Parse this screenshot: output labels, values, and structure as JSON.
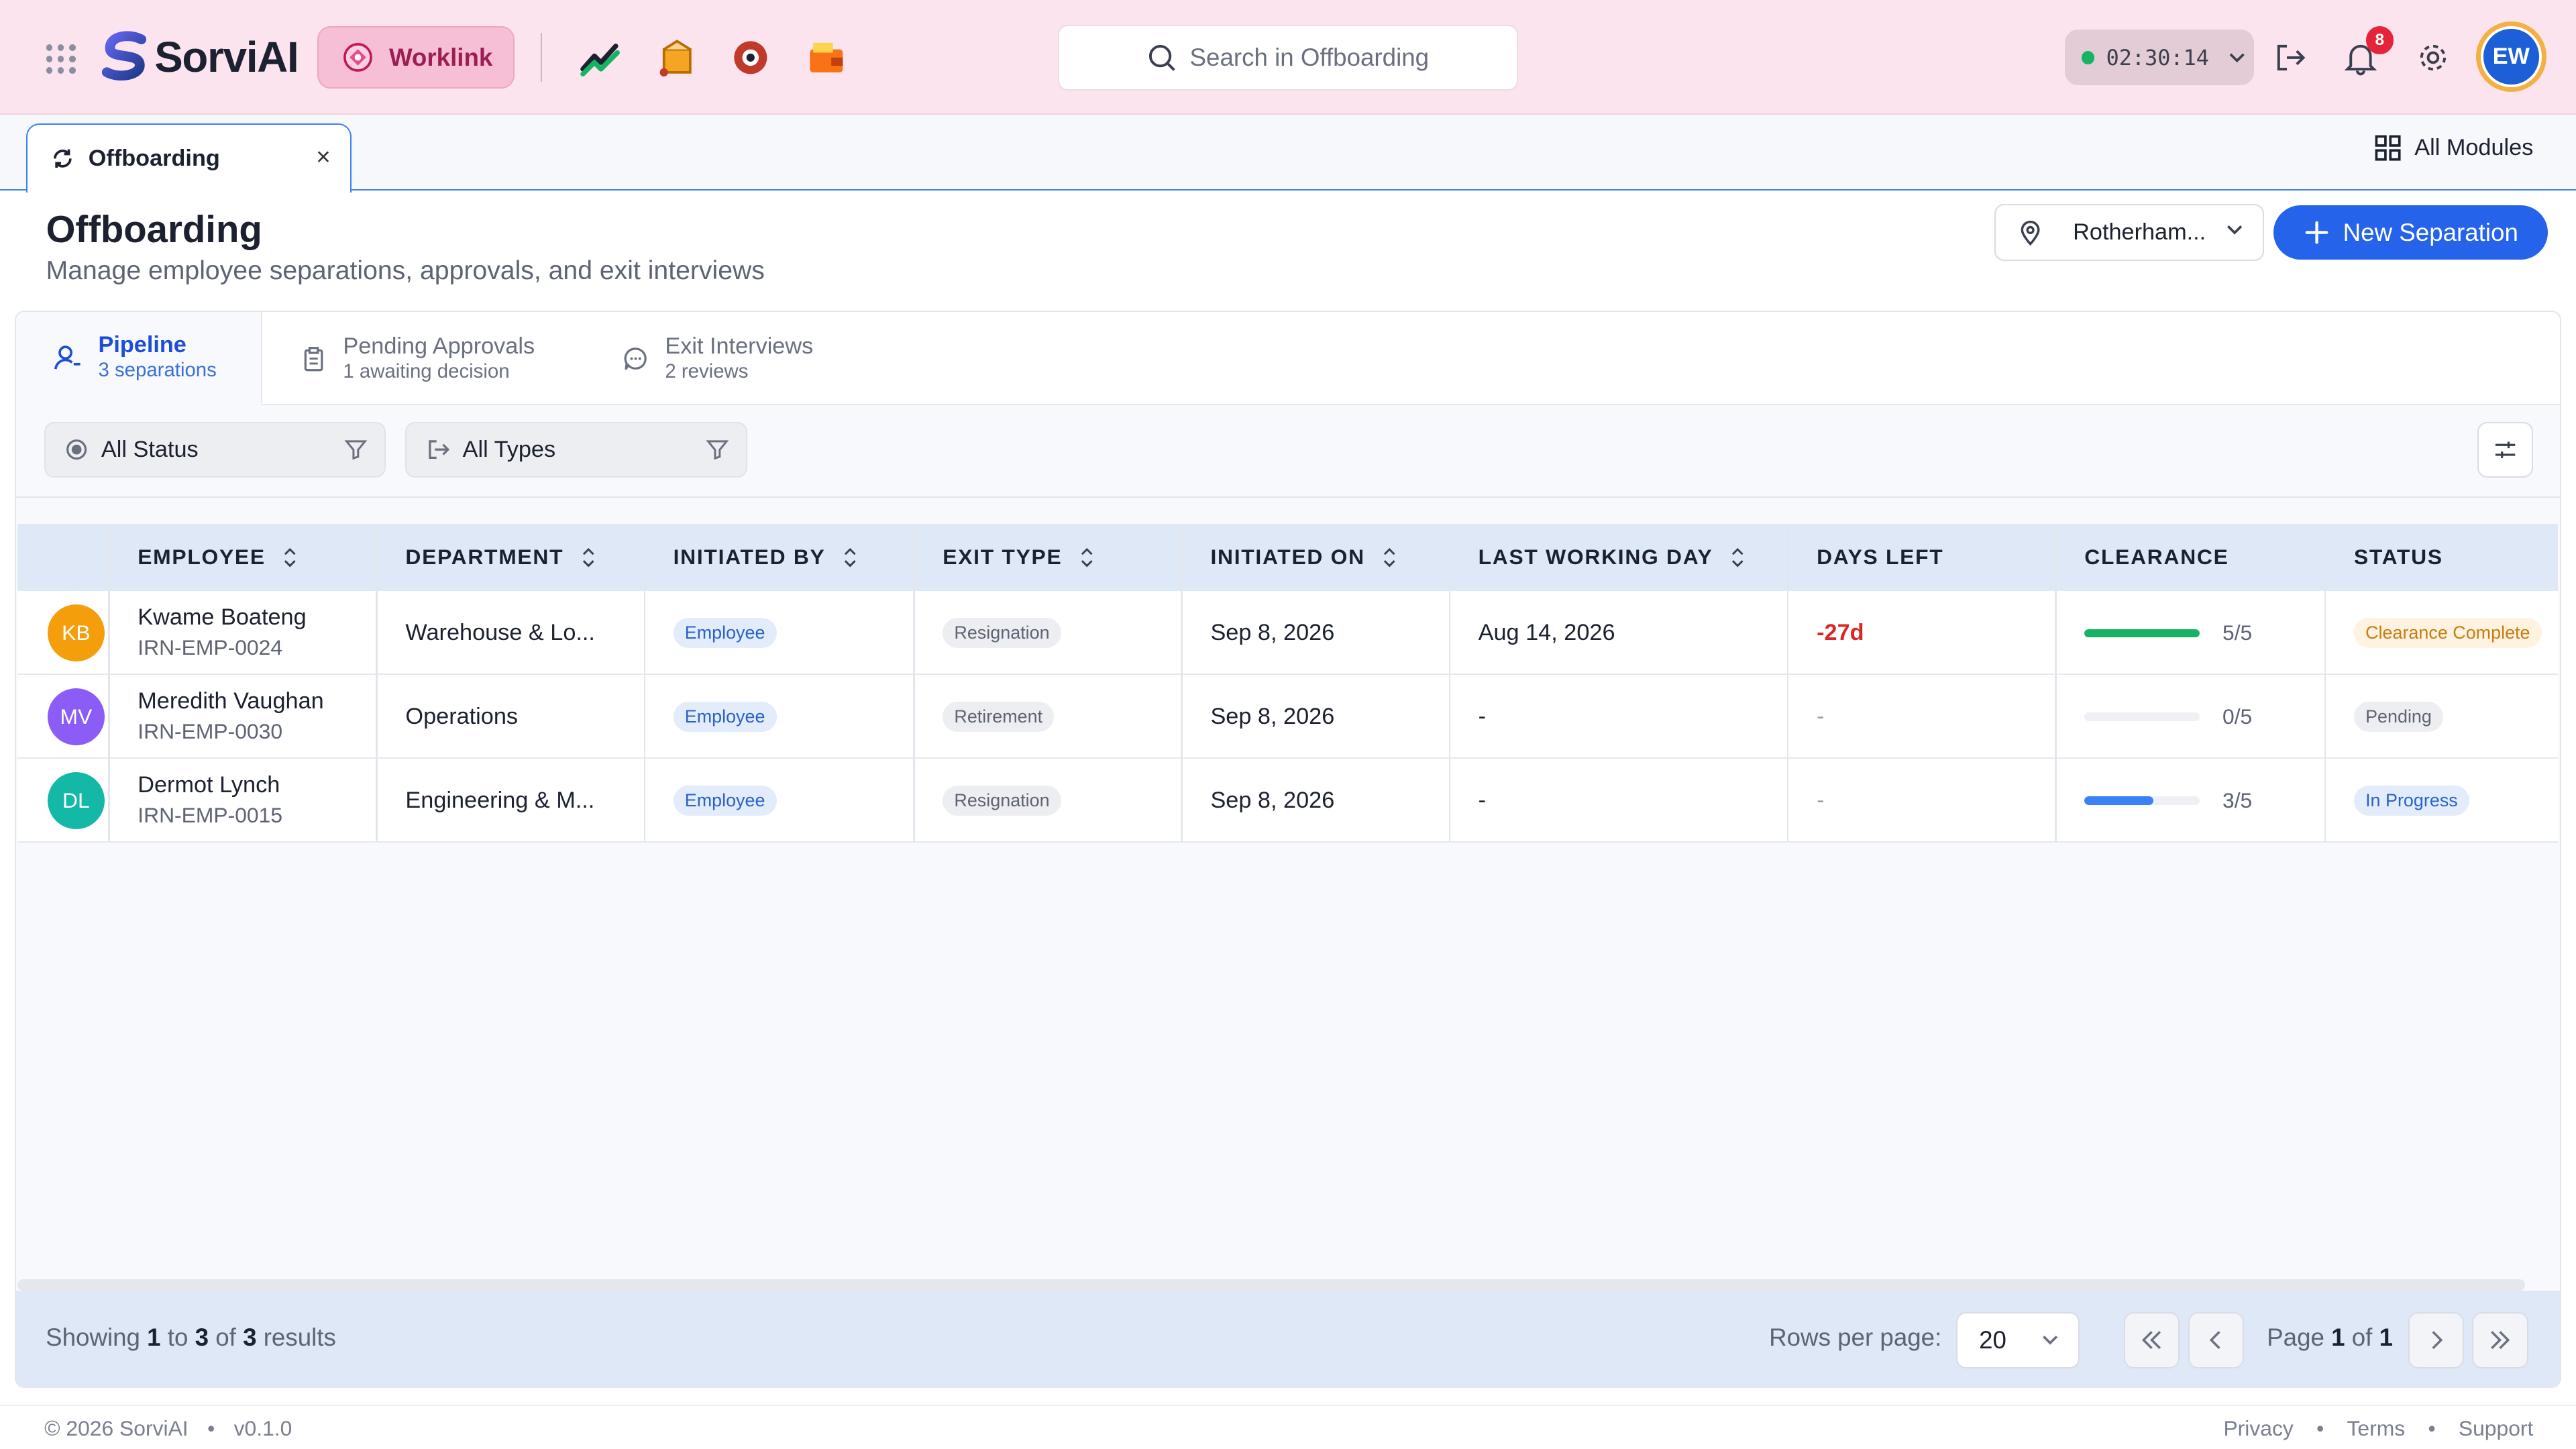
{
  "app": {
    "brand": "SorviAI",
    "module_button": "Worklink"
  },
  "search": {
    "placeholder": "Search in Offboarding"
  },
  "timer": {
    "value": "02:30:14"
  },
  "notifications": {
    "count": "8"
  },
  "user": {
    "initials": "EW"
  },
  "tab": {
    "label": "Offboarding",
    "close": "×"
  },
  "all_modules": "All Modules",
  "page": {
    "title": "Offboarding",
    "subtitle": "Manage employee separations, approvals, and exit interviews",
    "location": "Rotherham...",
    "new_button": "New Separation"
  },
  "subtabs": [
    {
      "label": "Pipeline",
      "sub": "3 separations"
    },
    {
      "label": "Pending Approvals",
      "sub": "1 awaiting decision"
    },
    {
      "label": "Exit Interviews",
      "sub": "2 reviews"
    }
  ],
  "filters": {
    "status": "All Status",
    "types": "All Types"
  },
  "columns": [
    "EMPLOYEE",
    "DEPARTMENT",
    "INITIATED BY",
    "EXIT TYPE",
    "INITIATED ON",
    "LAST WORKING DAY",
    "DAYS LEFT",
    "CLEARANCE",
    "STATUS"
  ],
  "rows": [
    {
      "initials": "KB",
      "avatar_color": "#f59e0b",
      "name": "Kwame Boateng",
      "id": "IRN-EMP-0024",
      "department": "Warehouse & Lo...",
      "initiated_by": "Employee",
      "exit_type": "Resignation",
      "initiated_on": "Sep 8, 2026",
      "last_day": "Aug 14, 2026",
      "days_left": "-27d",
      "clearance_text": "5/5",
      "clearance_fraction": 1.0,
      "clearance_color": "#16b364",
      "status": "Clearance Complete"
    },
    {
      "initials": "MV",
      "avatar_color": "#8b5cf6",
      "name": "Meredith Vaughan",
      "id": "IRN-EMP-0030",
      "department": "Operations",
      "initiated_by": "Employee",
      "exit_type": "Retirement",
      "initiated_on": "Sep 8, 2026",
      "last_day": "-",
      "days_left": "-",
      "clearance_text": "0/5",
      "clearance_fraction": 0.0,
      "clearance_color": "#3b82f6",
      "status": "Pending"
    },
    {
      "initials": "DL",
      "avatar_color": "#14b8a6",
      "name": "Dermot Lynch",
      "id": "IRN-EMP-0015",
      "department": "Engineering & M...",
      "initiated_by": "Employee",
      "exit_type": "Resignation",
      "initiated_on": "Sep 8, 2026",
      "last_day": "-",
      "days_left": "-",
      "clearance_text": "3/5",
      "clearance_fraction": 0.6,
      "clearance_color": "#3b82f6",
      "status": "In Progress"
    }
  ],
  "pagination": {
    "showing_prefix": "Showing",
    "from": "1",
    "to_word": "to",
    "to": "3",
    "of_word": "of",
    "total": "3",
    "results_word": "results",
    "rows_label": "Rows per page:",
    "rows_value": "20",
    "page_word": "Page",
    "page": "1",
    "page_of": "of",
    "pages": "1"
  },
  "footer": {
    "copyright": "© 2026 SorviAI",
    "version": "v0.1.0",
    "links": [
      "Privacy",
      "Terms",
      "Support"
    ]
  }
}
